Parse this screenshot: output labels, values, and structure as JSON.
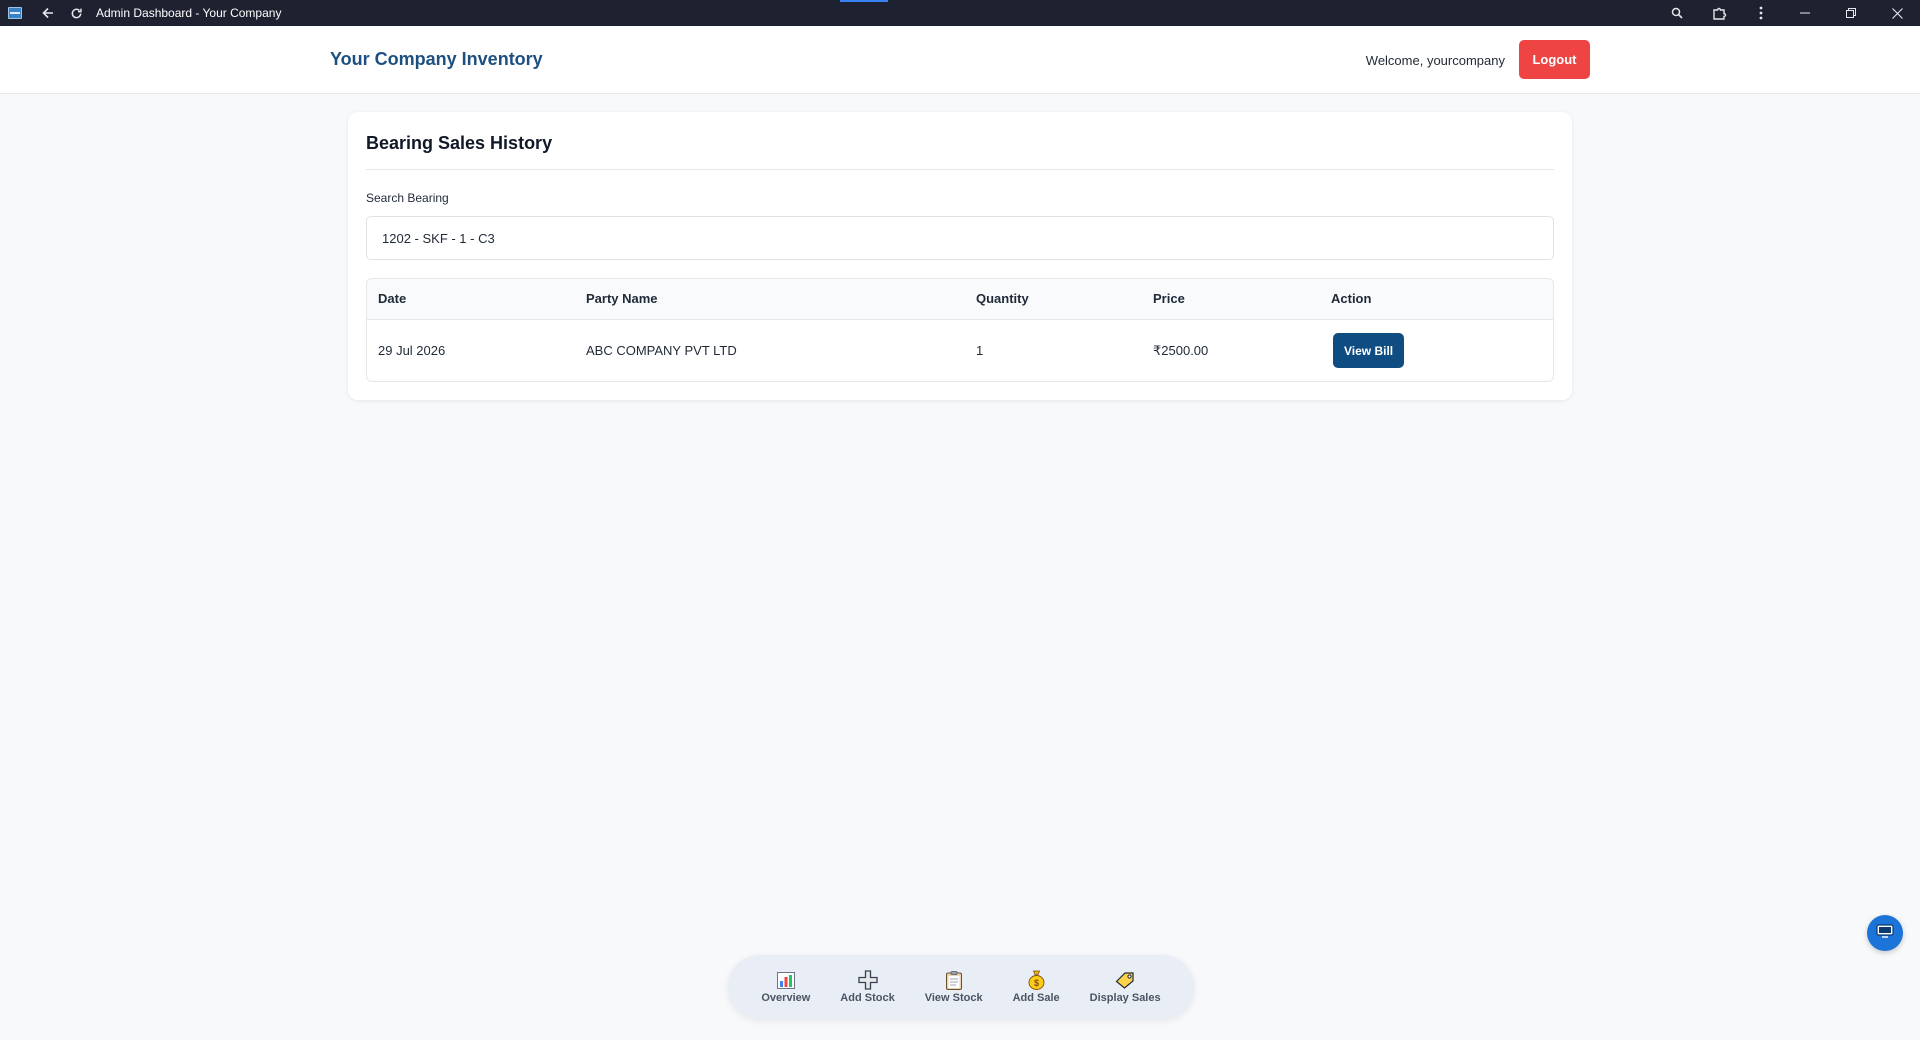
{
  "browser": {
    "title": "Admin Dashboard - Your Company"
  },
  "header": {
    "brand": "Your Company Inventory",
    "welcome": "Welcome, yourcompany",
    "logout_label": "Logout"
  },
  "card": {
    "title": "Bearing Sales History",
    "search_label": "Search Bearing",
    "search_value": "1202 - SKF - 1 - C3"
  },
  "table": {
    "headers": [
      "Date",
      "Party Name",
      "Quantity",
      "Price",
      "Action"
    ],
    "rows": [
      {
        "date": "29 Jul 2026",
        "party": "ABC COMPANY PVT LTD",
        "quantity": "1",
        "price": "₹2500.00",
        "action_label": "View Bill"
      }
    ]
  },
  "bottom_nav": {
    "items": [
      {
        "label": "Overview",
        "icon": "bar-chart-icon"
      },
      {
        "label": "Add Stock",
        "icon": "plus-icon"
      },
      {
        "label": "View Stock",
        "icon": "clipboard-icon"
      },
      {
        "label": "Add Sale",
        "icon": "money-bag-icon"
      },
      {
        "label": "Display Sales",
        "icon": "tag-icon"
      }
    ]
  },
  "colors": {
    "brand": "#1d5080",
    "logout": "#ef4444",
    "primary_button": "#0f4c81",
    "nav_background": "#e8edf6"
  }
}
